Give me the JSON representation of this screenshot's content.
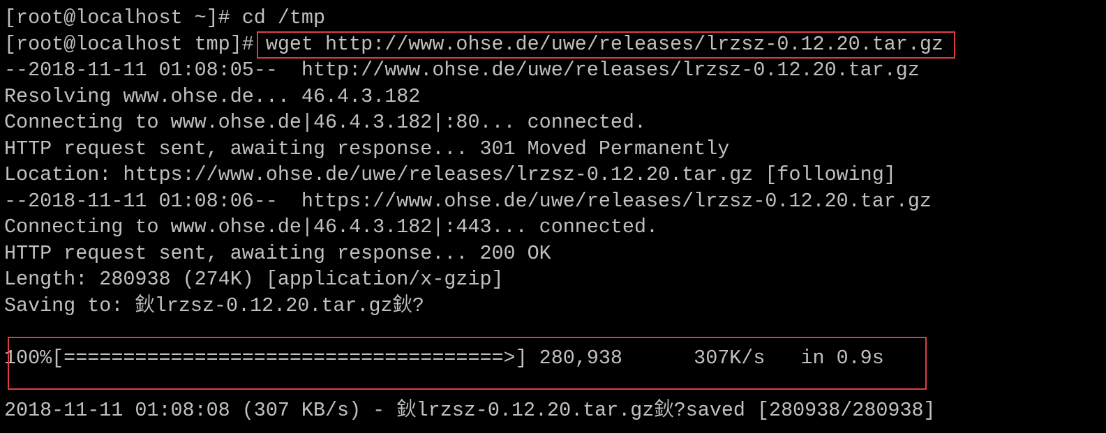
{
  "terminal": {
    "lines": [
      "[root@localhost ~]# cd /tmp",
      "[root@localhost tmp]# wget http://www.ohse.de/uwe/releases/lrzsz-0.12.20.tar.gz",
      "--2018-11-11 01:08:05--  http://www.ohse.de/uwe/releases/lrzsz-0.12.20.tar.gz",
      "Resolving www.ohse.de... 46.4.3.182",
      "Connecting to www.ohse.de|46.4.3.182|:80... connected.",
      "HTTP request sent, awaiting response... 301 Moved Permanently",
      "Location: https://www.ohse.de/uwe/releases/lrzsz-0.12.20.tar.gz [following]",
      "--2018-11-11 01:08:06--  https://www.ohse.de/uwe/releases/lrzsz-0.12.20.tar.gz",
      "Connecting to www.ohse.de|46.4.3.182|:443... connected.",
      "HTTP request sent, awaiting response... 200 OK",
      "Length: 280938 (274K) [application/x-gzip]",
      "Saving to: 鈥lrzsz-0.12.20.tar.gz鈥?",
      "",
      "100%[=====================================>] 280,938      307K/s   in 0.9s",
      "",
      "2018-11-11 01:08:08 (307 KB/s) - 鈥lrzsz-0.12.20.tar.gz鈥?saved [280938/280938]"
    ],
    "progress_percent": 100
  },
  "colors": {
    "text": "#c0c0c0",
    "background": "#000000",
    "highlight": "#e03c47"
  }
}
